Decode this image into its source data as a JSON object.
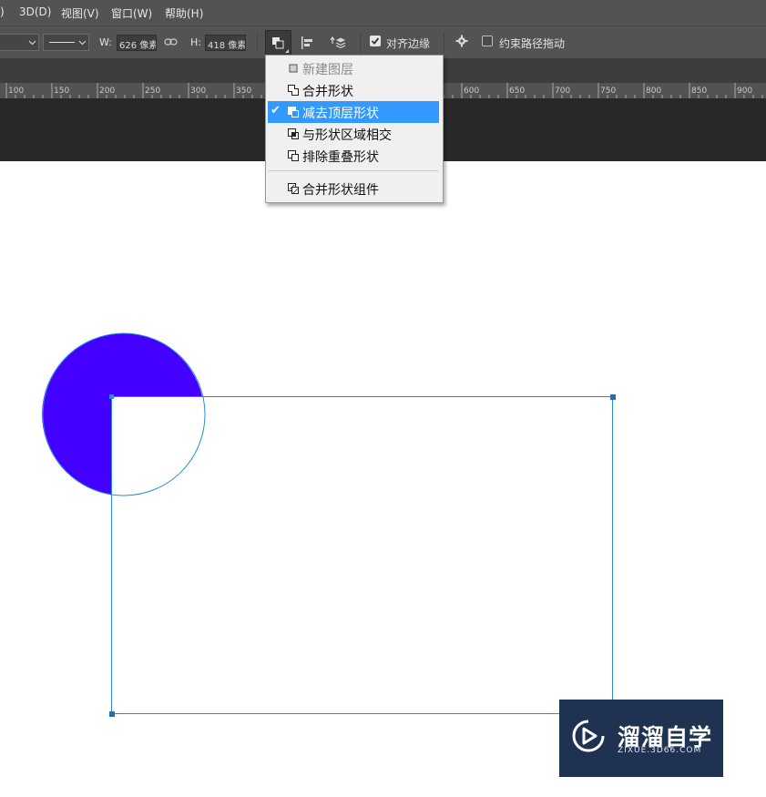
{
  "menubar": {
    "items": [
      ")",
      "3D(D)",
      "视图(V)",
      "窗口(W)",
      "帮助(H)"
    ]
  },
  "options": {
    "width_label": "W:",
    "width_value": "626 像素",
    "height_label": "H:",
    "height_value": "418 像素",
    "align_edges_label": "对齐边缘",
    "align_edges_checked": true,
    "constrain_label": "约束路径拖动",
    "constrain_checked": false
  },
  "ruler": {
    "ticks": [
      "100",
      "150",
      "200",
      "250",
      "300",
      "350",
      "600",
      "650",
      "700",
      "750",
      "800",
      "850",
      "900"
    ]
  },
  "path_operations_menu": {
    "items": [
      {
        "label": "新建图层",
        "icon": "new-layer-icon",
        "disabled": true,
        "selected": false
      },
      {
        "label": "合并形状",
        "icon": "combine-shapes-icon",
        "disabled": false,
        "selected": false
      },
      {
        "label": "减去顶层形状",
        "icon": "subtract-front-shape-icon",
        "disabled": false,
        "selected": true
      },
      {
        "label": "与形状区域相交",
        "icon": "intersect-shape-areas-icon",
        "disabled": false,
        "selected": false
      },
      {
        "label": "排除重叠形状",
        "icon": "exclude-overlapping-shapes-icon",
        "disabled": false,
        "selected": false
      },
      {
        "label": "合并形状组件",
        "icon": "merge-shape-components-icon",
        "disabled": false,
        "selected": false
      }
    ],
    "check_mark": "✔"
  },
  "colors": {
    "ui_dark": "#535353",
    "pasteboard": "#282828",
    "shape_fill": "#4400ff",
    "path_stroke": "#2a8ad8",
    "menu_highlight": "#3399ff",
    "watermark_bg": "#1f3252"
  },
  "watermark": {
    "title": "溜溜自学",
    "subtitle": "ZIXUE.3D66.COM"
  }
}
